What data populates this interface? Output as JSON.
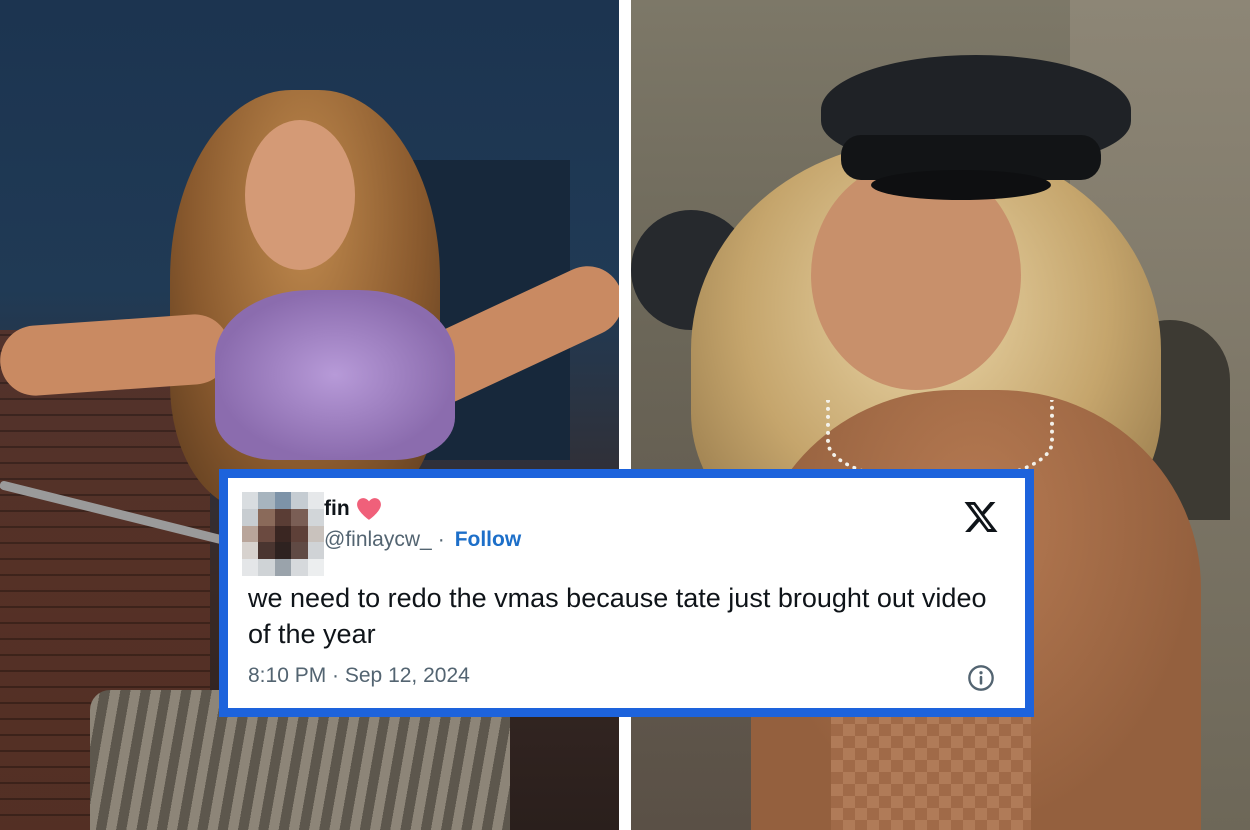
{
  "tweet": {
    "display_name": "fin",
    "name_emoji": "heart-icon",
    "handle": "@finlaycw_",
    "separator": "·",
    "follow_label": "Follow",
    "text": "we need to redo the vmas because tate just brought out video of the year",
    "timestamp": "8:10 PM · Sep 12, 2024",
    "brand_icon": "x-logo-icon",
    "info_icon": "info-icon"
  },
  "colors": {
    "card_border": "#1d63dc",
    "follow_link": "#1d6fc9",
    "heart": "#f0607a",
    "secondary_text": "#536471",
    "primary_text": "#0f1419"
  },
  "avatar_pixels": [
    "#d9dde0",
    "#a7b4be",
    "#7d93a8",
    "#c5ccd2",
    "#e6e8ea",
    "#c8cdd1",
    "#8a6a5a",
    "#5a3d35",
    "#7a5e55",
    "#d2d6d9",
    "#b9a59a",
    "#6b4a40",
    "#3a2622",
    "#5e4038",
    "#c9c2bd",
    "#d7d2ce",
    "#4a3530",
    "#2e2220",
    "#604a44",
    "#d0d3d6",
    "#e4e6e8",
    "#cfd3d6",
    "#9aa3ab",
    "#d6d9dc",
    "#eceeef"
  ]
}
